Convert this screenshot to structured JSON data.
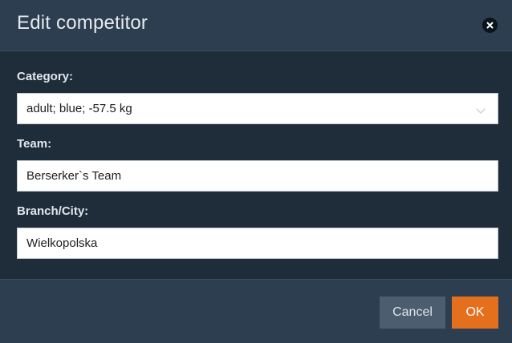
{
  "dialog": {
    "title": "Edit competitor",
    "close_icon": "close-icon"
  },
  "form": {
    "category": {
      "label": "Category:",
      "value": "adult; blue; -57.5 kg"
    },
    "team": {
      "label": "Team:",
      "value": "Berserker`s Team"
    },
    "branch": {
      "label": "Branch/City:",
      "value": "Wielkopolska"
    }
  },
  "footer": {
    "cancel_label": "Cancel",
    "ok_label": "OK"
  },
  "colors": {
    "accent": "#e46f1c",
    "header_bg": "#2c3e50",
    "body_bg": "#1f2d3b",
    "cancel_bg": "#4b5d6f"
  }
}
